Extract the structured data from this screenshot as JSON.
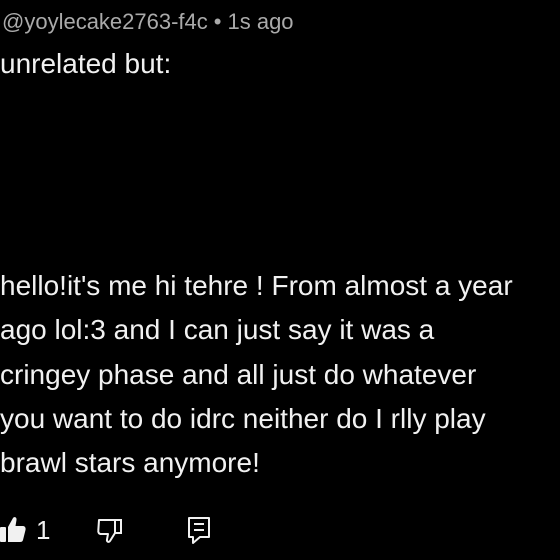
{
  "comment": {
    "author": "@yoylecake2763-f4c",
    "separator": "•",
    "timestamp": "1s ago",
    "lines": [
      "unrelated but:",
      "hello!it's me hi tehre ! From almost a year",
      "ago lol:3 and I can just say it was a",
      "cringey phase and all just do whatever",
      "you want to do idrc neither do I rlly play",
      "brawl stars anymore!"
    ]
  },
  "actions": {
    "like_count": "1",
    "like_icon": "thumbs-up-icon",
    "dislike_icon": "thumbs-down-icon",
    "reply_icon": "reply-icon"
  },
  "colors": {
    "background": "#000000",
    "text": "#f1f1f1",
    "meta": "#aaaaaa"
  }
}
